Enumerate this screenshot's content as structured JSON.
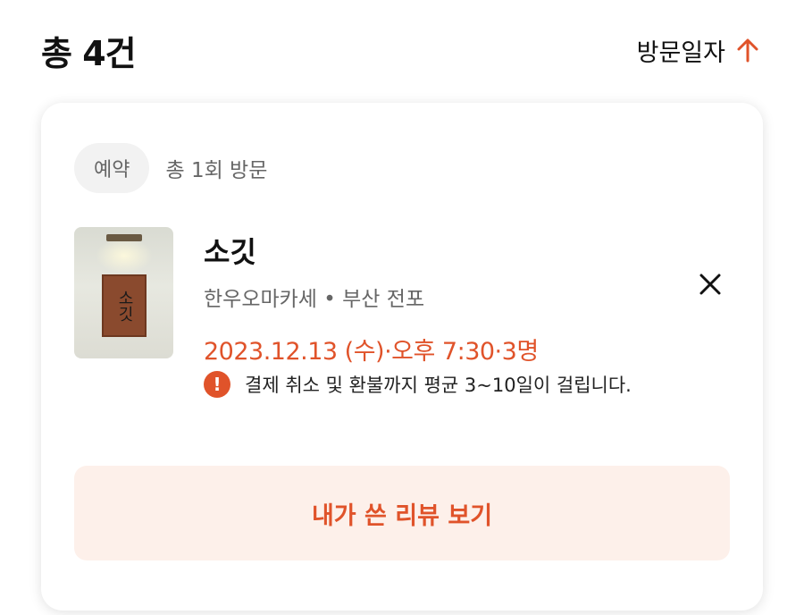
{
  "header": {
    "total_label": "총 4건",
    "sort_label": "방문일자",
    "sort_icon": "arrow-up-icon",
    "accent_color": "#e0532a"
  },
  "card": {
    "badge": "예약",
    "visit_count": "총 1회 방문",
    "restaurant_name": "소깃",
    "restaurant_subtitle": "한우오마카세 • 부산 전포",
    "reservation_datetime": "2023.12.13 (수)·오후 7:30·3명",
    "thumbnail_sign_text": "소깃",
    "notice_icon": "info-icon",
    "notice_text": "결제 취소 및 환불까지 평균 3~10일이 걸립니다.",
    "close_icon": "close-icon",
    "review_button_label": "내가 쓴 리뷰 보기"
  }
}
